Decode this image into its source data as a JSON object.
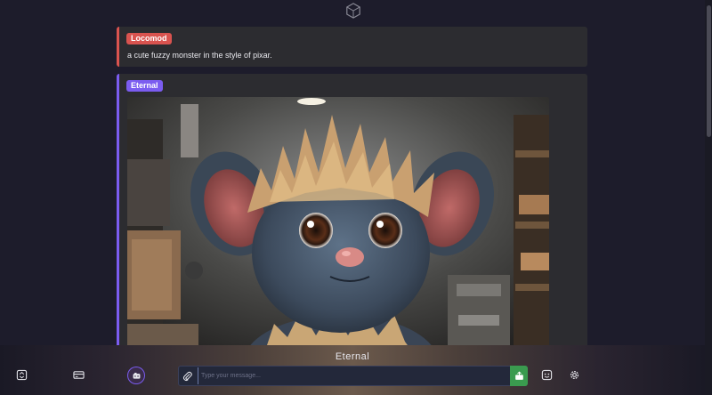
{
  "header": {
    "logo_icon": "cube-logo-icon"
  },
  "conversation": [
    {
      "sender": "Locomod",
      "text": "a cute fuzzy monster in the style of pixar.",
      "accent": "#d9534f"
    },
    {
      "sender": "Eternal",
      "image_description": "",
      "accent": "#7b5cf0"
    }
  ],
  "footer": {
    "brand": "Eternal",
    "input": {
      "value": "",
      "placeholder": "Type your message..."
    },
    "icons": {
      "left": [
        "upload-icon",
        "card-icon",
        "model-avatar-icon"
      ],
      "input": [
        "paperclip-icon",
        "send-icon"
      ],
      "right": [
        "face-icon",
        "gear-icon"
      ]
    },
    "colors": {
      "send_button": "#3a9b4f",
      "model_ring": "#7b5cf0"
    }
  }
}
